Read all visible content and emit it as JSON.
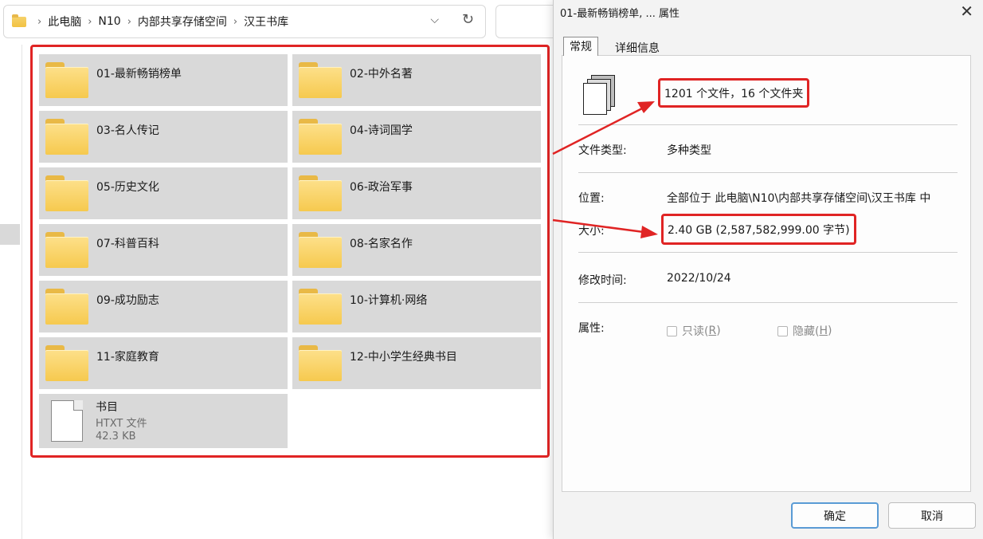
{
  "explorer": {
    "breadcrumb": [
      "此电脑",
      "N10",
      "内部共享存储空间",
      "汉王书库"
    ],
    "folders": [
      "01-最新畅销榜单",
      "02-中外名著",
      "03-名人传记",
      "04-诗词国学",
      "05-历史文化",
      "06-政治军事",
      "07-科普百科",
      "08-名家名作",
      "09-成功励志",
      "10-计算机·网络",
      "11-家庭教育",
      "12-中小学生经典书目"
    ],
    "file": {
      "name": "书目",
      "type": "HTXT 文件",
      "size": "42.3 KB"
    }
  },
  "dialog": {
    "title": "01-最新畅销榜单, ... 属性",
    "tabs": [
      "常规",
      "详细信息"
    ],
    "summary": "1201 个文件，16 个文件夹",
    "fields": {
      "type_label": "文件类型:",
      "type_value": "多种类型",
      "location_label": "位置:",
      "location_value": "全部位于 此电脑\\N10\\内部共享存储空间\\汉王书库 中",
      "size_label": "大小:",
      "size_value": "2.40 GB (2,587,582,999.00 字节)",
      "modified_label": "修改时间:",
      "modified_value": "2022/10/24",
      "attr_label": "属性:"
    },
    "readonly_text": "只读(",
    "readonly_key": "R",
    "hidden_text": "隐藏(",
    "hidden_key": "H",
    "ok": "确定",
    "cancel": "取消"
  },
  "colors": {
    "highlight": "#e02424",
    "folder": "#f6c94e",
    "tile": "#d9d9d9"
  }
}
